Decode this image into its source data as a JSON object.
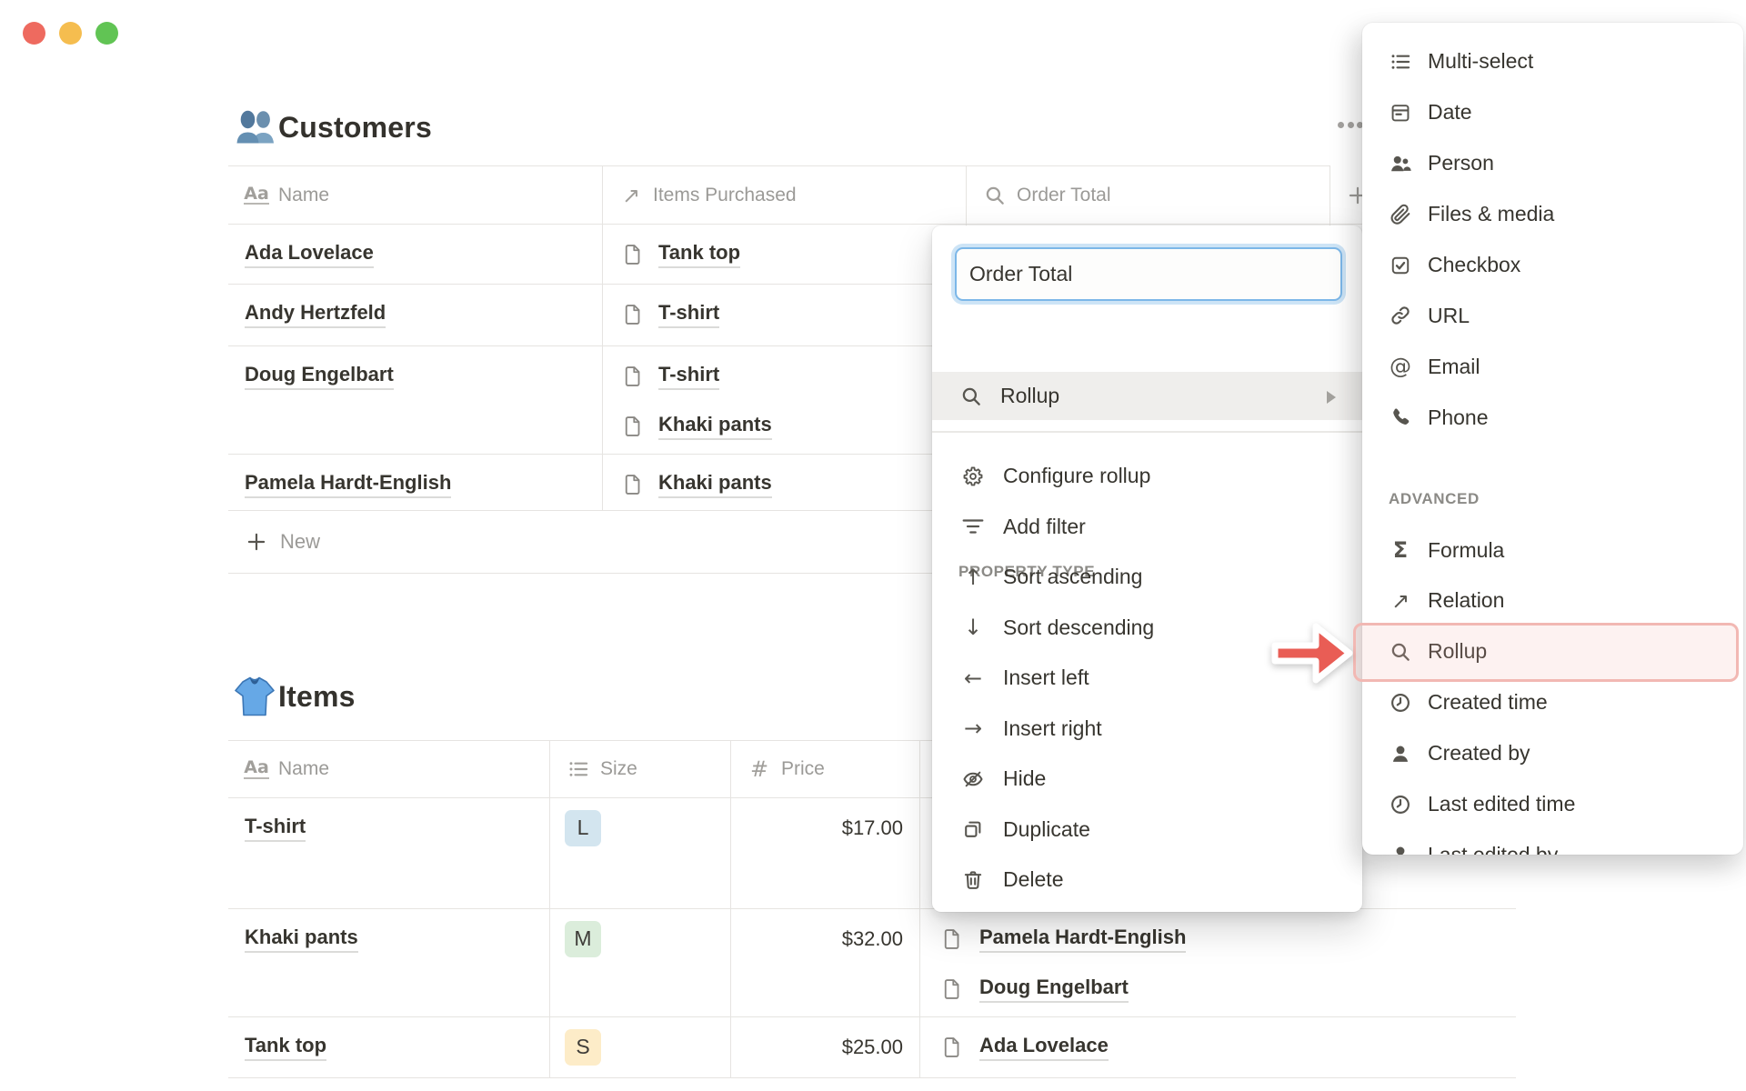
{
  "window": {
    "traffic_lights": [
      {
        "name": "close",
        "color": "#ee6a5f"
      },
      {
        "name": "minimize",
        "color": "#f5bd4f"
      },
      {
        "name": "zoom",
        "color": "#61c454"
      }
    ]
  },
  "customers": {
    "icon": "people-emoji",
    "title": "Customers",
    "more_icon": "dots-icon",
    "add_column_icon": "plus-icon",
    "columns": [
      {
        "icon": "text-icon",
        "label": "Name"
      },
      {
        "icon": "arrow-up-right-icon",
        "label": "Items Purchased"
      },
      {
        "icon": "search-icon",
        "label": "Order Total"
      }
    ],
    "rows": [
      {
        "name": "Ada Lovelace",
        "items": [
          "Tank top"
        ]
      },
      {
        "name": "Andy Hertzfeld",
        "items": [
          "T-shirt"
        ]
      },
      {
        "name": "Doug Engelbart",
        "items": [
          "T-shirt",
          "Khaki pants"
        ]
      },
      {
        "name": "Pamela Hardt-English",
        "items": [
          "Khaki pants"
        ]
      }
    ],
    "new_row": {
      "icon": "plus-icon",
      "label": "New"
    }
  },
  "items": {
    "icon": "tshirt-emoji",
    "title": "Items",
    "columns": [
      {
        "icon": "text-icon",
        "label": "Name"
      },
      {
        "icon": "list-icon",
        "label": "Size"
      },
      {
        "icon": "hash-icon",
        "label": "Price"
      },
      {
        "icon": null,
        "label": ""
      }
    ],
    "rows": [
      {
        "name": "T-shirt",
        "size": {
          "label": "L",
          "bg": "#d3e5ef"
        },
        "price": "$17.00",
        "customers": []
      },
      {
        "name": "Khaki pants",
        "size": {
          "label": "M",
          "bg": "#dbeddb"
        },
        "price": "$32.00",
        "customers": [
          "Pamela Hardt-English",
          "Doug Engelbart"
        ]
      },
      {
        "name": "Tank top",
        "size": {
          "label": "S",
          "bg": "#fdecc8"
        },
        "price": "$25.00",
        "customers": [
          "Ada Lovelace"
        ]
      }
    ]
  },
  "property_popup": {
    "name_value": "Order Total",
    "section_label": "PROPERTY TYPE",
    "selected_type": {
      "icon": "search-icon",
      "label": "Rollup",
      "submenu_icon": "chevron-right-icon"
    },
    "actions": [
      {
        "icon": "gear-icon",
        "label": "Configure rollup"
      },
      {
        "icon": "filter-icon",
        "label": "Add filter"
      },
      {
        "icon": "arrow-up-icon",
        "label": "Sort ascending"
      },
      {
        "icon": "arrow-down-icon",
        "label": "Sort descending"
      },
      {
        "icon": "arrow-left-icon",
        "label": "Insert left"
      },
      {
        "icon": "arrow-right-icon",
        "label": "Insert right"
      },
      {
        "icon": "eye-off-icon",
        "label": "Hide"
      },
      {
        "icon": "duplicate-icon",
        "label": "Duplicate"
      },
      {
        "icon": "trash-icon",
        "label": "Delete"
      }
    ]
  },
  "type_menu": {
    "items": [
      {
        "icon": "list-icon",
        "label": "Multi-select"
      },
      {
        "icon": "calendar-icon",
        "label": "Date"
      },
      {
        "icon": "person-icon",
        "label": "Person"
      },
      {
        "icon": "paperclip-icon",
        "label": "Files & media"
      },
      {
        "icon": "checkbox-icon",
        "label": "Checkbox"
      },
      {
        "icon": "link-icon",
        "label": "URL"
      },
      {
        "icon": "at-icon",
        "label": "Email"
      },
      {
        "icon": "phone-icon",
        "label": "Phone"
      }
    ],
    "advanced_label": "ADVANCED",
    "advanced_items": [
      {
        "icon": "sigma-icon",
        "label": "Formula"
      },
      {
        "icon": "arrow-up-right-icon",
        "label": "Relation"
      },
      {
        "icon": "search-icon",
        "label": "Rollup",
        "highlighted": true
      },
      {
        "icon": "clock-icon",
        "label": "Created time"
      },
      {
        "icon": "person-filled-icon",
        "label": "Created by"
      },
      {
        "icon": "clock-icon",
        "label": "Last edited time"
      },
      {
        "icon": "person-filled-icon",
        "label": "Last edited by"
      }
    ]
  },
  "annotation": {
    "arrow_icon": "annotation-arrow-icon",
    "arrow_color": "#e95d55",
    "highlight_border": "#f2b8b3",
    "highlight_fill": "rgba(242,184,179,0.18)"
  },
  "colors": {
    "ink": "#37352f",
    "muted": "#9b9a97",
    "border": "#e6e4e1",
    "focus_ring": "#7cb7e8",
    "selected_row": "#efeeec"
  }
}
